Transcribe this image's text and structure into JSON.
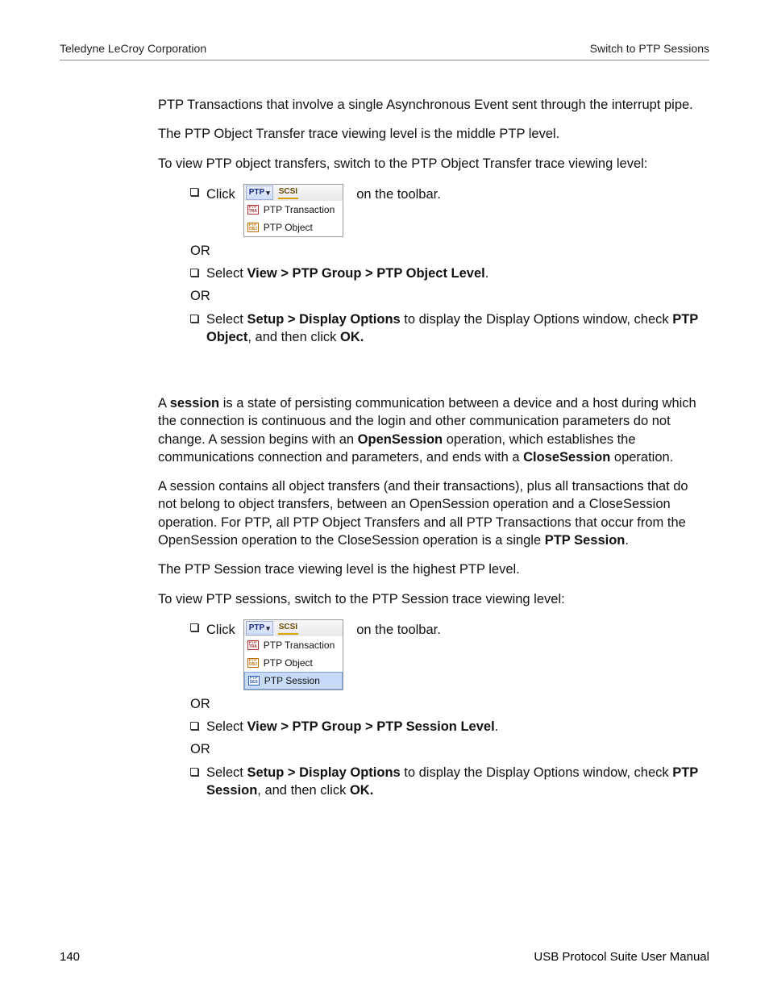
{
  "header": {
    "left": "Teledyne LeCroy Corporation",
    "right": "Switch to PTP Sessions"
  },
  "intro": {
    "p1": "PTP Transactions that involve a single Asynchronous Event sent through the interrupt pipe.",
    "p2": "The PTP Object Transfer trace viewing level is the middle PTP level.",
    "p3": "To view PTP object transfers, switch to the PTP Object Transfer trace viewing level:"
  },
  "block1": {
    "click_label": "Click",
    "on_toolbar": " on the toolbar.",
    "menu": {
      "ptp_label": "PTP",
      "scsi_label": "SCSI",
      "item1": "PTP Transaction",
      "item2": "PTP Object"
    },
    "or": "OR",
    "select1_pre": "Select ",
    "select1_bold": "View > PTP Group > PTP Object Level",
    "select1_post": ".",
    "select2_pre": "Select ",
    "select2_bold1": "Setup > Display Options",
    "select2_mid": " to display the Display Options window, check ",
    "select2_bold2": "PTP Object",
    "select2_mid2": ", and then click ",
    "select2_bold3": "OK."
  },
  "session": {
    "p1_pre": "A ",
    "p1_b1": "session",
    "p1_mid1": " is a state of persisting communication between a device and a host during which the connection is continuous and the login and other communication parameters do not change. A session begins with an ",
    "p1_b2": "OpenSession",
    "p1_mid2": " operation, which establishes the communications connection and parameters, and ends with a ",
    "p1_b3": "CloseSession",
    "p1_post": " operation.",
    "p2_pre": "A session contains all object transfers (and their transactions), plus all transactions that do not belong to object transfers, between an OpenSession operation and a CloseSession operation. For PTP, all PTP Object Transfers and all PTP Transactions that occur from the OpenSession operation to the CloseSession operation is a single ",
    "p2_b": "PTP Session",
    "p2_post": ".",
    "p3": "The PTP Session trace viewing level is the highest PTP level.",
    "p4": "To view PTP sessions, switch to the PTP Session trace viewing level:"
  },
  "block2": {
    "click_label": "Click",
    "on_toolbar": " on the toolbar.",
    "menu": {
      "ptp_label": "PTP",
      "scsi_label": "SCSI",
      "item1": "PTP Transaction",
      "item2": "PTP Object",
      "item3": "PTP Session"
    },
    "or": "OR",
    "select1_pre": "Select ",
    "select1_bold": "View > PTP Group > PTP Session Level",
    "select1_post": ".",
    "select2_pre": "Select ",
    "select2_bold1": "Setup > Display Options",
    "select2_mid": " to display the Display Options window, check ",
    "select2_bold2": "PTP Session",
    "select2_mid2": ", and then click ",
    "select2_bold3": "OK."
  },
  "footer": {
    "page": "140",
    "title": "USB Protocol Suite User Manual"
  }
}
